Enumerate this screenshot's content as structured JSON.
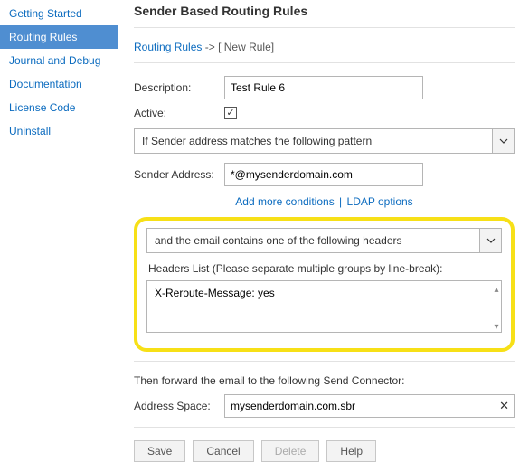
{
  "sidebar": {
    "items": [
      {
        "label": "Getting Started"
      },
      {
        "label": "Routing Rules"
      },
      {
        "label": "Journal and Debug"
      },
      {
        "label": "Documentation"
      },
      {
        "label": "License Code"
      },
      {
        "label": "Uninstall"
      }
    ],
    "active_index": 1
  },
  "header": {
    "title": "Sender Based Routing Rules"
  },
  "breadcrumb": {
    "link": "Routing Rules",
    "current": "[ New Rule]",
    "separator": "->"
  },
  "fields": {
    "description_label": "Description:",
    "description_value": "Test Rule 6",
    "active_label": "Active:",
    "active_checked": true,
    "condition1_value": "If Sender address matches the following pattern",
    "sender_label": "Sender Address:",
    "sender_value": "*@mysenderdomain.com",
    "more_conditions": "Add more conditions",
    "ldap_options": "LDAP options",
    "condition2_value": "and the email contains one of the following headers",
    "headers_label": "Headers List (Please separate multiple groups by line-break):",
    "headers_value": "X-Reroute-Message: yes",
    "then_label": "Then forward the email to the following Send Connector:",
    "address_label": "Address Space:",
    "address_value": "mysenderdomain.com.sbr"
  },
  "buttons": {
    "save": "Save",
    "cancel": "Cancel",
    "delete": "Delete",
    "help": "Help"
  }
}
